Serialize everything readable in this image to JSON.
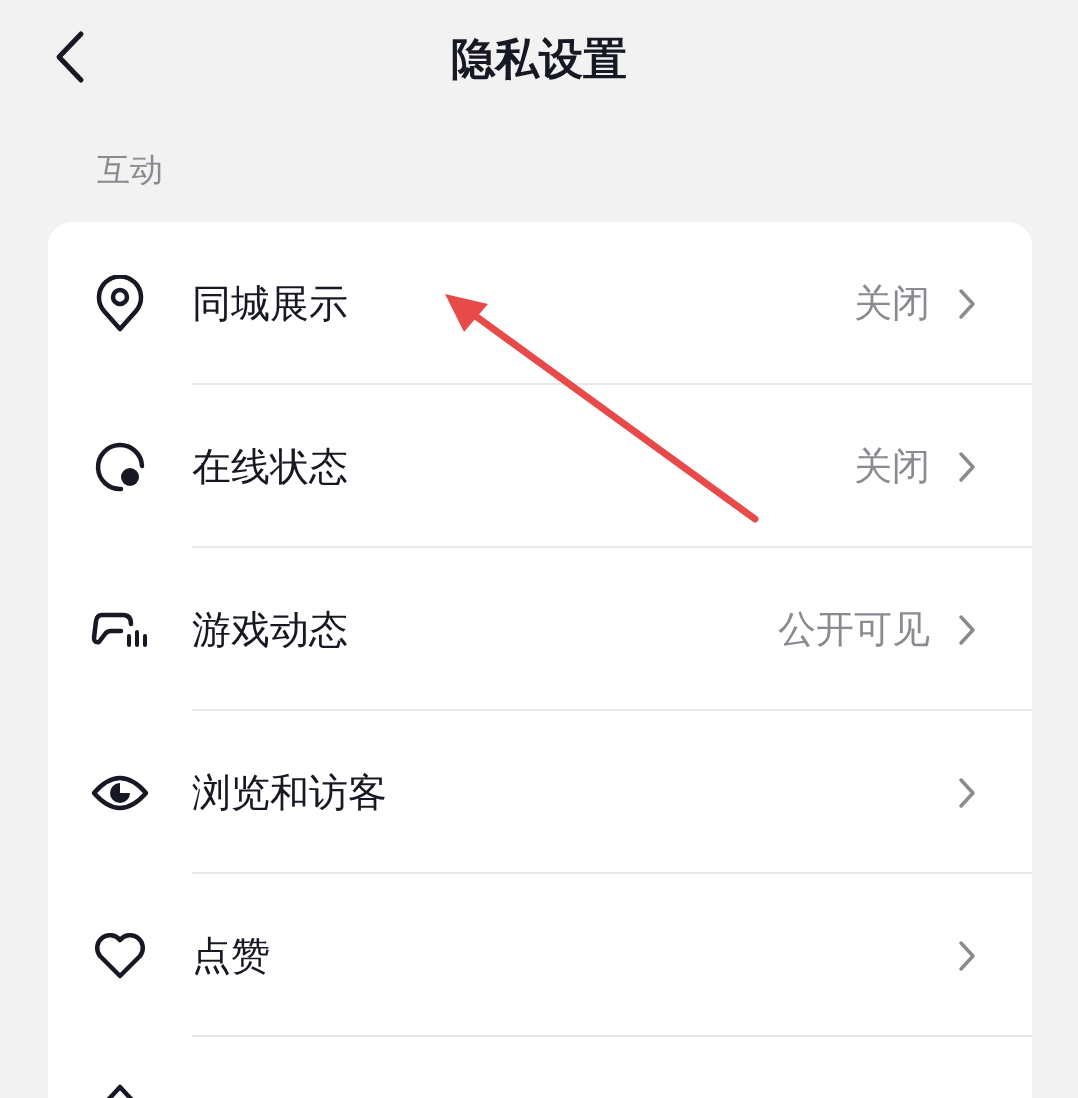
{
  "header": {
    "title": "隐私设置"
  },
  "section": {
    "title": "互动"
  },
  "rows": [
    {
      "label": "同城展示",
      "value": "关闭"
    },
    {
      "label": "在线状态",
      "value": "关闭"
    },
    {
      "label": "游戏动态",
      "value": "公开可见"
    },
    {
      "label": "浏览和访客"
    },
    {
      "label": "点赞"
    }
  ]
}
